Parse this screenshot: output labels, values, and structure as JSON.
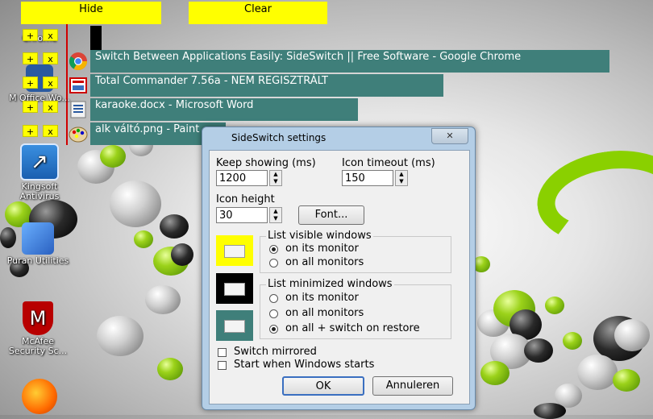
{
  "topbar": {
    "hide_label": "Hide",
    "clear_label": "Clear"
  },
  "desktop_icons": [
    {
      "label": "Chrome"
    },
    {
      "label": "M Office Wo..."
    },
    {
      "label": "Kingsoft Antivirus"
    },
    {
      "label": "Puran Utilities"
    },
    {
      "label": "McAfee Security Sc..."
    }
  ],
  "row_controls": {
    "plus": "+",
    "close": "x"
  },
  "windows": [
    {
      "title": "Switch Between Applications Easily: SideSwitch || Free Software - Google Chrome",
      "icon": "chrome-icon"
    },
    {
      "title": "Total Commander 7.56a - NEM REGISZTRÁLT",
      "icon": "total-commander-icon"
    },
    {
      "title": "karaoke.docx - Microsoft Word",
      "icon": "word-icon"
    },
    {
      "title": "alk váltó.png - Paint",
      "icon": "paint-icon"
    }
  ],
  "dialog": {
    "title": "SideSwitch settings",
    "close_label": "✕",
    "keep_showing_label": "Keep showing (ms)",
    "keep_showing_value": "1200",
    "icon_timeout_label": "Icon timeout (ms)",
    "icon_timeout_value": "150",
    "icon_height_label": "Icon height",
    "icon_height_value": "30",
    "font_button": "Font...",
    "visible_group": {
      "title": "List visible windows",
      "options": [
        "on its monitor",
        "on all monitors"
      ],
      "selected": 0,
      "color": "#ffff00"
    },
    "minimized_group": {
      "title": "List minimized windows",
      "options": [
        "on its monitor",
        "on all monitors",
        "on all + switch on restore"
      ],
      "selected": 2,
      "color": "#000000"
    },
    "third_swatch_color": "#3f7f7a",
    "switch_mirrored": "Switch mirrored",
    "start_when_windows_starts": "Start when Windows starts",
    "ok_label": "OK",
    "cancel_label": "Annuleren"
  }
}
